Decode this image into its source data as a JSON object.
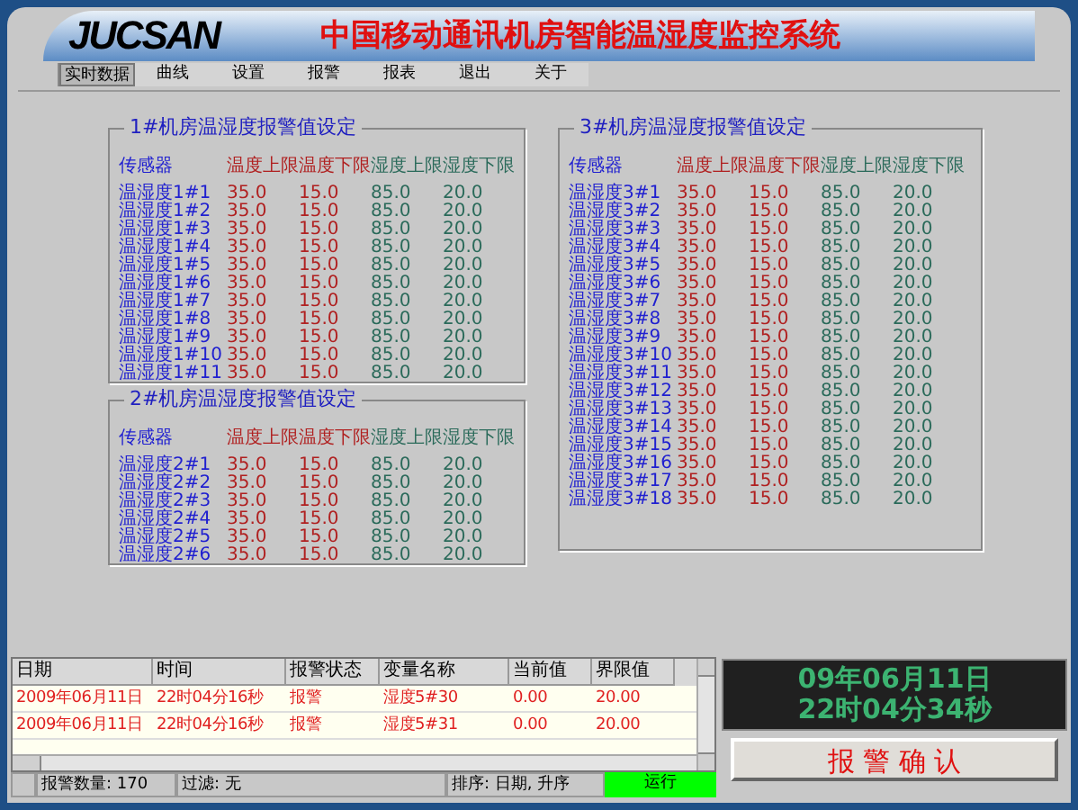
{
  "header": {
    "logo": "JUCSAN",
    "title": "中国移动通讯机房智能温湿度监控系统"
  },
  "menu": [
    {
      "label": "实时数据",
      "selected": true
    },
    {
      "label": "曲线",
      "selected": false
    },
    {
      "label": "设置",
      "selected": false
    },
    {
      "label": "报警",
      "selected": false
    },
    {
      "label": "报表",
      "selected": false
    },
    {
      "label": "退出",
      "selected": false
    },
    {
      "label": "关于",
      "selected": false
    }
  ],
  "panels": [
    {
      "title": "1#机房温湿度报警值设定",
      "columns": [
        "传感器",
        "温度上限",
        "温度下限",
        "湿度上限",
        "湿度下限"
      ],
      "rows": [
        [
          "温湿度1#1",
          "35.0",
          "15.0",
          "85.0",
          "20.0"
        ],
        [
          "温湿度1#2",
          "35.0",
          "15.0",
          "85.0",
          "20.0"
        ],
        [
          "温湿度1#3",
          "35.0",
          "15.0",
          "85.0",
          "20.0"
        ],
        [
          "温湿度1#4",
          "35.0",
          "15.0",
          "85.0",
          "20.0"
        ],
        [
          "温湿度1#5",
          "35.0",
          "15.0",
          "85.0",
          "20.0"
        ],
        [
          "温湿度1#6",
          "35.0",
          "15.0",
          "85.0",
          "20.0"
        ],
        [
          "温湿度1#7",
          "35.0",
          "15.0",
          "85.0",
          "20.0"
        ],
        [
          "温湿度1#8",
          "35.0",
          "15.0",
          "85.0",
          "20.0"
        ],
        [
          "温湿度1#9",
          "35.0",
          "15.0",
          "85.0",
          "20.0"
        ],
        [
          "温湿度1#10",
          "35.0",
          "15.0",
          "85.0",
          "20.0"
        ],
        [
          "温湿度1#11",
          "35.0",
          "15.0",
          "85.0",
          "20.0"
        ]
      ]
    },
    {
      "title": "2#机房温湿度报警值设定",
      "columns": [
        "传感器",
        "温度上限",
        "温度下限",
        "湿度上限",
        "湿度下限"
      ],
      "rows": [
        [
          "温湿度2#1",
          "35.0",
          "15.0",
          "85.0",
          "20.0"
        ],
        [
          "温湿度2#2",
          "35.0",
          "15.0",
          "85.0",
          "20.0"
        ],
        [
          "温湿度2#3",
          "35.0",
          "15.0",
          "85.0",
          "20.0"
        ],
        [
          "温湿度2#4",
          "35.0",
          "15.0",
          "85.0",
          "20.0"
        ],
        [
          "温湿度2#5",
          "35.0",
          "15.0",
          "85.0",
          "20.0"
        ],
        [
          "温湿度2#6",
          "35.0",
          "15.0",
          "85.0",
          "20.0"
        ]
      ]
    },
    {
      "title": "3#机房温湿度报警值设定",
      "columns": [
        "传感器",
        "温度上限",
        "温度下限",
        "湿度上限",
        "湿度下限"
      ],
      "rows": [
        [
          "温湿度3#1",
          "35.0",
          "15.0",
          "85.0",
          "20.0"
        ],
        [
          "温湿度3#2",
          "35.0",
          "15.0",
          "85.0",
          "20.0"
        ],
        [
          "温湿度3#3",
          "35.0",
          "15.0",
          "85.0",
          "20.0"
        ],
        [
          "温湿度3#4",
          "35.0",
          "15.0",
          "85.0",
          "20.0"
        ],
        [
          "温湿度3#5",
          "35.0",
          "15.0",
          "85.0",
          "20.0"
        ],
        [
          "温湿度3#6",
          "35.0",
          "15.0",
          "85.0",
          "20.0"
        ],
        [
          "温湿度3#7",
          "35.0",
          "15.0",
          "85.0",
          "20.0"
        ],
        [
          "温湿度3#8",
          "35.0",
          "15.0",
          "85.0",
          "20.0"
        ],
        [
          "温湿度3#9",
          "35.0",
          "15.0",
          "85.0",
          "20.0"
        ],
        [
          "温湿度3#10",
          "35.0",
          "15.0",
          "85.0",
          "20.0"
        ],
        [
          "温湿度3#11",
          "35.0",
          "15.0",
          "85.0",
          "20.0"
        ],
        [
          "温湿度3#12",
          "35.0",
          "15.0",
          "85.0",
          "20.0"
        ],
        [
          "温湿度3#13",
          "35.0",
          "15.0",
          "85.0",
          "20.0"
        ],
        [
          "温湿度3#14",
          "35.0",
          "15.0",
          "85.0",
          "20.0"
        ],
        [
          "温湿度3#15",
          "35.0",
          "15.0",
          "85.0",
          "20.0"
        ],
        [
          "温湿度3#16",
          "35.0",
          "15.0",
          "85.0",
          "20.0"
        ],
        [
          "温湿度3#17",
          "35.0",
          "15.0",
          "85.0",
          "20.0"
        ],
        [
          "温湿度3#18",
          "35.0",
          "15.0",
          "85.0",
          "20.0"
        ]
      ]
    }
  ],
  "alarm_table": {
    "columns": [
      "日期",
      "时间",
      "报警状态",
      "变量名称",
      "当前值",
      "界限值"
    ],
    "rows": [
      [
        "2009年06月11日",
        "22时04分16秒",
        "报警",
        "湿度5#30",
        "0.00",
        "20.00"
      ],
      [
        "2009年06月11日",
        "22时04分16秒",
        "报警",
        "湿度5#31",
        "0.00",
        "20.00"
      ]
    ]
  },
  "status_bar": {
    "count": "报警数量: 170",
    "filter": "过滤: 无",
    "sort": "排序: 日期, 升序",
    "state": "运行",
    "running": true
  },
  "clock": {
    "date": "09年06月11日",
    "time": "22时04分34秒"
  },
  "ack_button": "报 警 确 认"
}
